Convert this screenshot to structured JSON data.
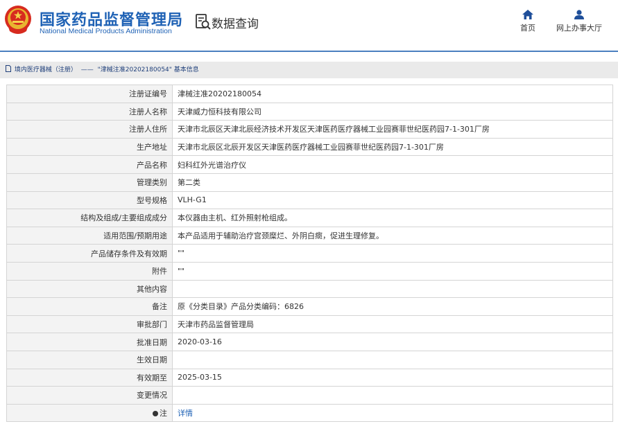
{
  "header": {
    "title": "国家药品监督管理局",
    "subtitle": "National Medical Products Administration",
    "query_label": "数据查询",
    "nav": [
      {
        "label": "首页",
        "icon": "home-icon"
      },
      {
        "label": "网上办事大厅",
        "icon": "user-icon"
      }
    ]
  },
  "breadcrumb": {
    "section": "境内医疗器械（注册）",
    "separator": "——",
    "current": "\"津械注准20202180054\" 基本信息"
  },
  "details": [
    {
      "label": "注册证编号",
      "value": "津械注准20202180054"
    },
    {
      "label": "注册人名称",
      "value": "天津威力恒科技有限公司"
    },
    {
      "label": "注册人住所",
      "value": "天津市北辰区天津北辰经济技术开发区天津医药医疗器械工业园赛菲世纪医药园7-1-301厂房"
    },
    {
      "label": "生产地址",
      "value": "天津市北辰区北辰开发区天津医药医疗器械工业园赛菲世纪医药园7-1-301厂房"
    },
    {
      "label": "产品名称",
      "value": "妇科红外光谱治疗仪"
    },
    {
      "label": "管理类别",
      "value": "第二类"
    },
    {
      "label": "型号规格",
      "value": "VLH-G1"
    },
    {
      "label": "结构及组成/主要组成成分",
      "value": "本仪器由主机、红外照射枪组成。"
    },
    {
      "label": "适用范围/预期用途",
      "value": "本产品适用于辅助治疗宫颈糜烂、外阴白癍，促进生理修复。"
    },
    {
      "label": "产品储存条件及有效期",
      "value": "\"\""
    },
    {
      "label": "附件",
      "value": "\"\""
    },
    {
      "label": "其他内容",
      "value": ""
    },
    {
      "label": "备注",
      "value": "原《分类目录》产品分类编码：6826"
    },
    {
      "label": "审批部门",
      "value": "天津市药品监督管理局"
    },
    {
      "label": "批准日期",
      "value": "2020-03-16"
    },
    {
      "label": "生效日期",
      "value": ""
    },
    {
      "label": "有效期至",
      "value": "2025-03-15"
    },
    {
      "label": "变更情况",
      "value": ""
    }
  ],
  "note": {
    "label": "注",
    "link": "详情"
  },
  "colors": {
    "brand": "#1f62b5",
    "rule": "#4a7fbf",
    "label_bg": "#f3f3f3",
    "border": "#d4d4d4"
  }
}
